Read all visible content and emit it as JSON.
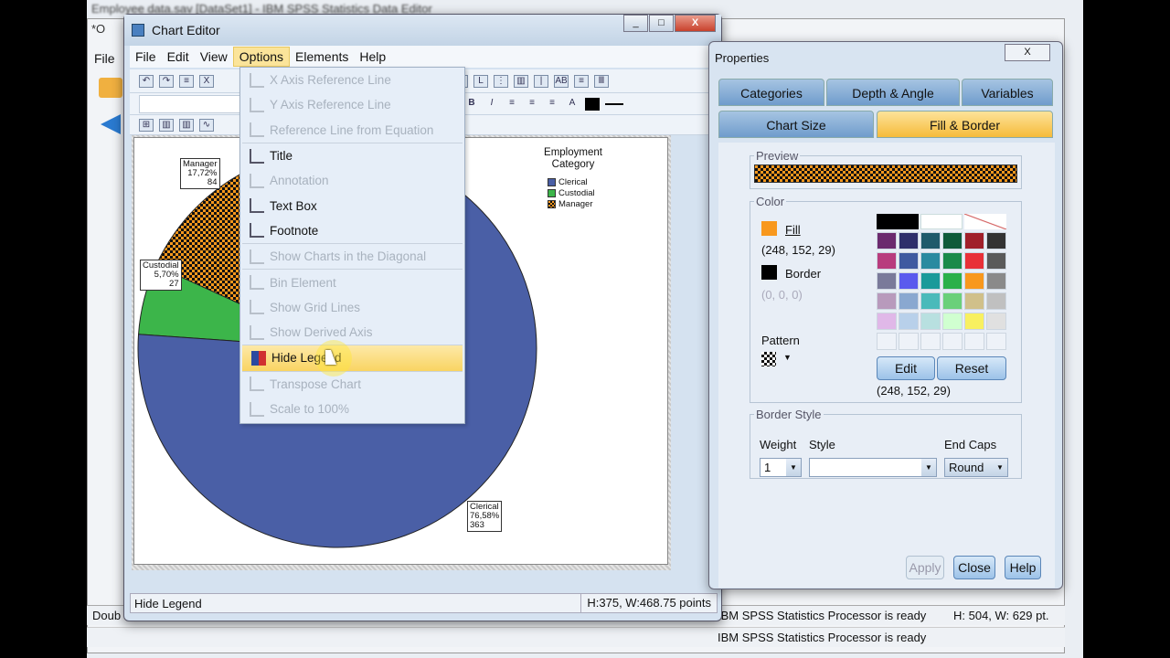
{
  "background_window": {
    "title": "Employee data.sav [DataSet1] - IBM SPSS Statistics Data Editor",
    "title2": "*O",
    "file_menu": "File",
    "status_left": "Doub",
    "status_processor": "IBM SPSS Statistics Processor is ready",
    "status_size": "H: 504, W: 629 pt.",
    "status_processor2": "IBM SPSS Statistics Processor is ready"
  },
  "chart_editor": {
    "title": "Chart Editor",
    "menu": [
      "File",
      "Edit",
      "View",
      "Options",
      "Elements",
      "Help"
    ],
    "status_text": "Hide Legend",
    "status_size": "H:375, W:468.75 points"
  },
  "options_menu": {
    "items": [
      {
        "label": "X Axis Reference Line",
        "enabled": false,
        "icon": "x-axis-reference-line-icon"
      },
      {
        "label": "Y Axis Reference Line",
        "enabled": false,
        "icon": "y-axis-reference-line-icon"
      },
      {
        "label": "Reference Line from Equation",
        "enabled": false,
        "icon": "reference-line-equation-icon"
      },
      {
        "label": "Title",
        "enabled": true,
        "icon": "title-icon"
      },
      {
        "label": "Annotation",
        "enabled": false,
        "icon": "annotation-icon"
      },
      {
        "label": "Text Box",
        "enabled": true,
        "icon": "text-box-icon"
      },
      {
        "label": "Footnote",
        "enabled": true,
        "icon": "footnote-icon"
      },
      {
        "label": "Show Charts in the Diagonal",
        "enabled": false,
        "icon": "diagonal-charts-icon"
      },
      {
        "label": "Bin Element",
        "enabled": false,
        "icon": "bin-element-icon"
      },
      {
        "label": "Show Grid Lines",
        "enabled": false,
        "icon": "grid-lines-icon"
      },
      {
        "label": "Show Derived Axis",
        "enabled": false,
        "icon": "derived-axis-icon"
      },
      {
        "label": "Hide Legend",
        "enabled": true,
        "highlighted": true,
        "icon": "legend-icon"
      },
      {
        "label": "Transpose Chart",
        "enabled": false,
        "icon": "transpose-chart-icon"
      },
      {
        "label": "Scale to 100%",
        "enabled": false,
        "icon": "scale-100-icon"
      }
    ]
  },
  "chart_data": {
    "type": "pie",
    "legend_title": "Employment Category",
    "legend_position": "top-right",
    "slices": [
      {
        "name": "Clerical",
        "percent": 76.58,
        "percent_label": "76,58%",
        "count": 363,
        "count_label": "363",
        "color": "#4a5fa6",
        "pattern": "solid"
      },
      {
        "name": "Custodial",
        "percent": 5.7,
        "percent_label": "5,70%",
        "count": 27,
        "count_label": "27",
        "color": "#3cb54a",
        "pattern": "solid"
      },
      {
        "name": "Manager",
        "percent": 17.72,
        "percent_label": "17,72%",
        "count": 84,
        "count_label": "84",
        "color": "#f8981d",
        "pattern": "checkered"
      }
    ]
  },
  "properties": {
    "title": "Properties",
    "tabs_row1": [
      "Categories",
      "Depth & Angle",
      "Variables"
    ],
    "tabs_row2": [
      "Chart Size",
      "Fill & Border"
    ],
    "active_tab": "Fill & Border",
    "preview_label": "Preview",
    "color_label": "Color",
    "fill_label": "Fill",
    "fill_color": "#f8981d",
    "fill_rgb": "(248, 152, 29)",
    "border_label": "Border",
    "border_color": "#000000",
    "border_rgb": "(0, 0, 0)",
    "pattern_label": "Pattern",
    "edit_button": "Edit",
    "reset_button": "Reset",
    "selected_rgb": "(248, 152, 29)",
    "palette": [
      [
        "#6b2a6e",
        "#2e2f6b",
        "#1f5a6b",
        "#0f5a3a",
        "#a01f2a",
        "#333333"
      ],
      [
        "#b83c7e",
        "#3f5aa0",
        "#2a8aa0",
        "#1a8a4a",
        "#e83038",
        "#5a5a5a"
      ],
      [
        "#7a7a9a",
        "#5a5aee",
        "#1a9a9a",
        "#2ab04a",
        "#f8981d",
        "#8a8a8a"
      ],
      [
        "#b89abc",
        "#8aa8d0",
        "#4ababa",
        "#6ad07a",
        "#d0c08a",
        "#c0c0c0"
      ],
      [
        "#e0b8e8",
        "#b8d0ea",
        "#b8e0e0",
        "#d0ffd0",
        "#f8f060",
        "#e0e0e0"
      ],
      [
        "#eef2f8",
        "#eef2f8",
        "#eef2f8",
        "#eef2f8",
        "#eef2f8",
        "#eef2f8"
      ]
    ],
    "border_style_label": "Border Style",
    "weight_label": "Weight",
    "weight_value": "1",
    "style_label": "Style",
    "end_caps_label": "End Caps",
    "end_caps_value": "Round",
    "apply_button": "Apply",
    "close_button": "Close",
    "help_button": "Help"
  }
}
